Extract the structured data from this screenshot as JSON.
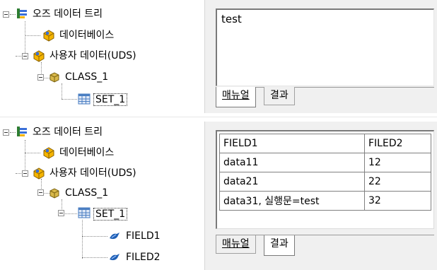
{
  "top": {
    "tree": [
      {
        "label": "오즈 데이터 트리"
      },
      {
        "label": "데이터베이스"
      },
      {
        "label": "사용자 데이터(UDS)"
      },
      {
        "label": "CLASS_1"
      },
      {
        "label": "SET_1"
      }
    ],
    "editor": {
      "text": "test"
    },
    "tabs": [
      {
        "label": "매뉴얼",
        "active": true
      },
      {
        "label": "결과",
        "active": false
      }
    ]
  },
  "bottom": {
    "tree": [
      {
        "label": "오즈 데이터 트리"
      },
      {
        "label": "데이터베이스"
      },
      {
        "label": "사용자 데이터(UDS)"
      },
      {
        "label": "CLASS_1"
      },
      {
        "label": "SET_1"
      },
      {
        "label": "FIELD1"
      },
      {
        "label": "FILED2"
      }
    ],
    "grid": {
      "columns": [
        "FIELD1",
        "FILED2"
      ],
      "rows": [
        [
          "data11",
          "12"
        ],
        [
          "data21",
          "22"
        ],
        [
          "data31, 실행문=test",
          "32"
        ]
      ]
    },
    "tabs": [
      {
        "label": "매뉴얼",
        "active": false
      },
      {
        "label": "결과",
        "active": true
      }
    ]
  },
  "colors": {
    "tree_root_icon": "#2e7d32",
    "db_icon": "#f4b400",
    "class_icon": "#c9a227",
    "set_icon": "#4a7ec2",
    "field_icon": "#1e5fb4"
  }
}
